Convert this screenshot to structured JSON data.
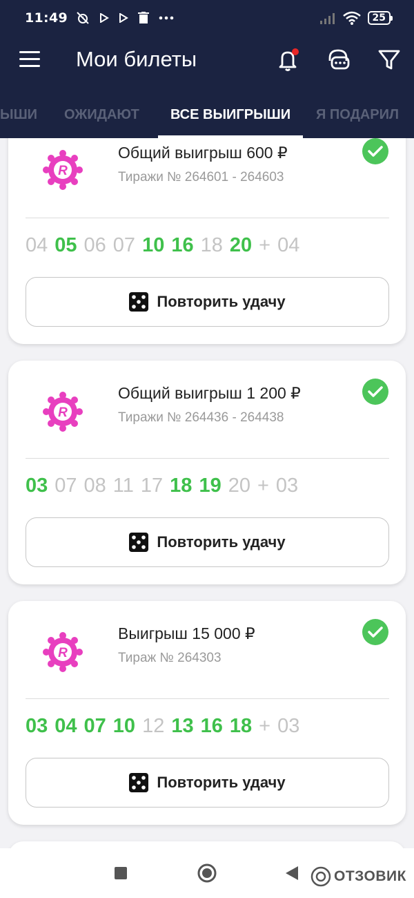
{
  "status_bar": {
    "time": "11:49",
    "battery": "25"
  },
  "header": {
    "title": "Мои билеты"
  },
  "tabs": [
    {
      "label": "ЫШИ"
    },
    {
      "label": "ОЖИДАЮТ"
    },
    {
      "label": "ВСЕ ВЫИГРЫШИ",
      "active": true
    },
    {
      "label": "Я ПОДАРИЛ"
    }
  ],
  "tickets": [
    {
      "title": "Общий выигрыш 600 ₽",
      "subtitle": "Тиражи № 264601 - 264603",
      "numbers": [
        {
          "v": "04",
          "hit": false
        },
        {
          "v": "05",
          "hit": true
        },
        {
          "v": "06",
          "hit": false
        },
        {
          "v": "07",
          "hit": false
        },
        {
          "v": "10",
          "hit": true
        },
        {
          "v": "16",
          "hit": true
        },
        {
          "v": "18",
          "hit": false
        },
        {
          "v": "20",
          "hit": true
        },
        {
          "v": "+",
          "hit": false
        },
        {
          "v": "04",
          "hit": false
        }
      ],
      "button": "Повторить удачу"
    },
    {
      "title": "Общий выигрыш 1 200 ₽",
      "subtitle": "Тиражи № 264436 - 264438",
      "numbers": [
        {
          "v": "03",
          "hit": true
        },
        {
          "v": "07",
          "hit": false
        },
        {
          "v": "08",
          "hit": false
        },
        {
          "v": "11",
          "hit": false
        },
        {
          "v": "17",
          "hit": false
        },
        {
          "v": "18",
          "hit": true
        },
        {
          "v": "19",
          "hit": true
        },
        {
          "v": "20",
          "hit": false
        },
        {
          "v": "+",
          "hit": false
        },
        {
          "v": "03",
          "hit": false
        }
      ],
      "button": "Повторить удачу"
    },
    {
      "title": "Выигрыш 15 000 ₽",
      "subtitle": "Тираж № 264303",
      "numbers": [
        {
          "v": "03",
          "hit": true
        },
        {
          "v": "04",
          "hit": true
        },
        {
          "v": "07",
          "hit": true
        },
        {
          "v": "10",
          "hit": true
        },
        {
          "v": "12",
          "hit": false
        },
        {
          "v": "13",
          "hit": true
        },
        {
          "v": "16",
          "hit": true
        },
        {
          "v": "18",
          "hit": true
        },
        {
          "v": "+",
          "hit": false
        },
        {
          "v": "03",
          "hit": false
        }
      ],
      "button": "Повторить удачу"
    }
  ],
  "watermark": "ОТЗОВИК",
  "colors": {
    "header_bg": "#1b2341",
    "hit_green": "#3fc04b",
    "logo_pink": "#e83fbf",
    "check_green": "#4cc55a"
  }
}
